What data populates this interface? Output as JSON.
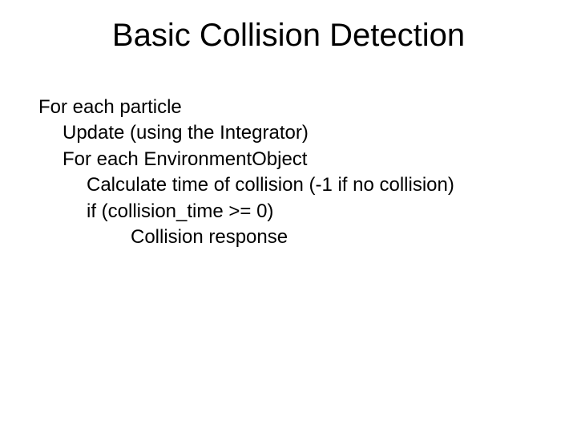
{
  "slide": {
    "title": "Basic Collision Detection",
    "lines": [
      "For each particle",
      "Update (using the Integrator)",
      "For each EnvironmentObject",
      "Calculate time of collision (-1 if no collision)",
      "if (collision_time >= 0)",
      "Collision response"
    ]
  }
}
